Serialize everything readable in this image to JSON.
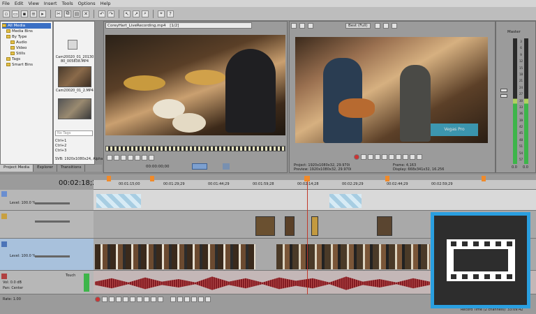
{
  "menu": [
    "File",
    "Edit",
    "View",
    "Insert",
    "Tools",
    "Options",
    "Help"
  ],
  "explorer": {
    "tree": [
      "All Media",
      "Media Bins",
      "By Type",
      "Audio",
      "Video",
      "Stills",
      "Tags",
      "Smart Bins"
    ],
    "thumbs": [
      "Cam20020_01_2013080_005838.MP4",
      "Cam20020_01_2.MP4"
    ],
    "search_placeholder": "No Tags",
    "info": [
      "Ctrl+1",
      "Ctrl+2",
      "Ctrl+3"
    ],
    "media_info": "SVB: 1920x1080x24, Alpha",
    "tabs": [
      "Project Media",
      "Explorer",
      "Transitions"
    ]
  },
  "trimmer": {
    "file": "CoreyHart_LiveRecording.mp4",
    "zoom": "[1/2]",
    "timecode": "00:00:00;00"
  },
  "preview": {
    "quality": "Best (Full)",
    "watermark": "Vegas Pro",
    "project_label": "Project:",
    "project_value": "1920x1080x32, 29.970i",
    "preview_label": "Preview:",
    "preview_value": "1920x1080x32, 29.970i",
    "frame_label": "Frame:",
    "frame_value": "4,163",
    "display_label": "Display:",
    "display_value": "668x341x32, 16.256"
  },
  "mixer": {
    "title": "Master",
    "value_l": "0.0",
    "value_r": "0.0",
    "scale": [
      "3",
      "6",
      "9",
      "12",
      "15",
      "18",
      "21",
      "24",
      "27",
      "30",
      "33",
      "36",
      "39",
      "42",
      "45",
      "48",
      "51",
      "54",
      "57"
    ]
  },
  "timeline": {
    "timecode": "00:02:18;27",
    "ruler": [
      "00:01:15;00",
      "00:01:29;29",
      "00:01:44;29",
      "00:01:59;28",
      "00:02:14;28",
      "00:02:29;29",
      "00:02:44;29",
      "00:02:59;29"
    ],
    "level": "Level: 100.0 %",
    "vol_label": "Vol:",
    "vol_value": "0.0 dB",
    "pan_label": "Pan:",
    "pan_value": "Center",
    "touch": "Touch",
    "rate": "Rate: 1.00",
    "record_info": "Record Time (2 channels): 33:09:42"
  }
}
